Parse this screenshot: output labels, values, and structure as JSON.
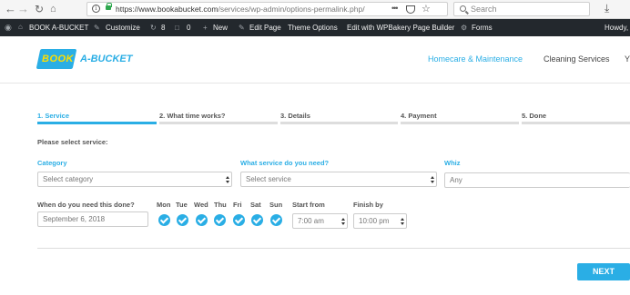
{
  "browser": {
    "url_host": "https://www.bookabucket.com",
    "url_path": "/services/wp-admin/options-permalink.php/",
    "url_more": "•••",
    "search_placeholder": "Search"
  },
  "admin_bar": {
    "site_name": "BOOK A-BUCKET",
    "customize": "Customize",
    "updates_count": "8",
    "comments_count": "0",
    "new": "New",
    "edit_page": "Edit Page",
    "theme_options": "Theme Options",
    "wpbakery": "Edit with WPBakery Page Builder",
    "forms": "Forms",
    "howdy": "Howdy,"
  },
  "header": {
    "logo_book": "BOOK",
    "logo_rest": "A-BUCKET",
    "nav": [
      "Homecare & Maintenance",
      "Cleaning Services",
      "Y"
    ]
  },
  "steps": [
    {
      "label": "1. Service",
      "active": true
    },
    {
      "label": "2. What time works?",
      "active": false
    },
    {
      "label": "3. Details",
      "active": false
    },
    {
      "label": "4. Payment",
      "active": false
    },
    {
      "label": "5. Done",
      "active": false
    }
  ],
  "form": {
    "section_title": "Please select service:",
    "category_label": "Category",
    "category_value": "Select category",
    "service_label": "What service do you need?",
    "service_value": "Select service",
    "whiz_label": "Whiz",
    "whiz_value": "Any",
    "date_label": "When do you need this done?",
    "date_value": "September 6, 2018",
    "days": [
      "Mon",
      "Tue",
      "Wed",
      "Thu",
      "Fri",
      "Sat",
      "Sun"
    ],
    "start_label": "Start from",
    "start_value": "7:00 am",
    "finish_label": "Finish by",
    "finish_value": "10:00 pm",
    "next_label": "NEXT"
  },
  "colors": {
    "accent": "#2aaee5",
    "admin_bar": "#23282d",
    "logo_yellow": "#ffde00"
  }
}
